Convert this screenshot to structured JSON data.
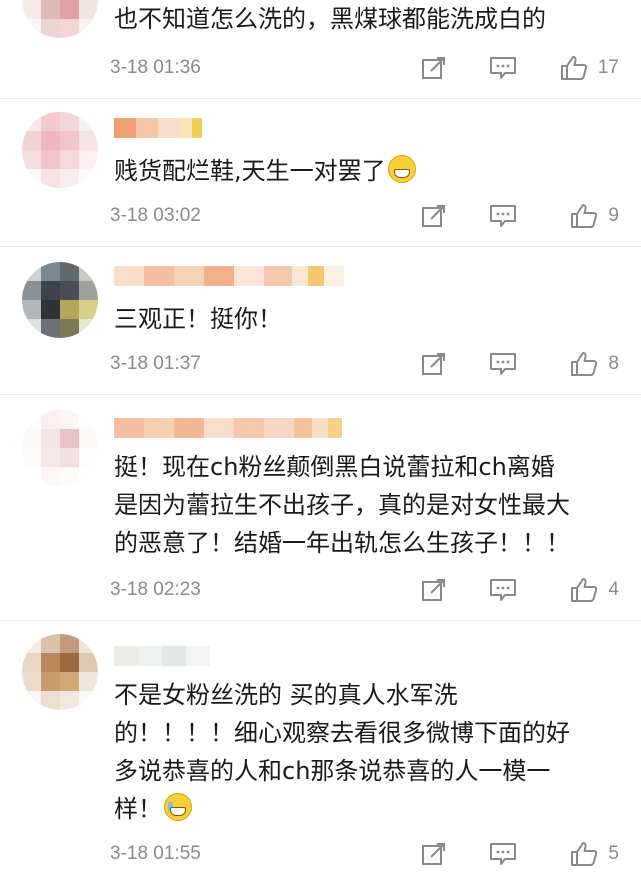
{
  "comments": [
    {
      "text": "也不知道怎么洗的，黑煤球都能洗成白的",
      "time": "3-18 01:36",
      "likes": "17",
      "emoji": ""
    },
    {
      "text": "贱货配烂鞋,天生一对罢了",
      "time": "3-18 03:02",
      "likes": "9",
      "emoji": "grin"
    },
    {
      "text": "三观正！挺你！",
      "time": "3-18 01:37",
      "likes": "8",
      "emoji": ""
    },
    {
      "text": "挺！现在ch粉丝颠倒黑白说蕾拉和ch离婚\n是因为蕾拉生不出孩子，真的是对女性最大\n的恶意了！结婚一年出轨怎么生孩子！！！",
      "time": "3-18 02:23",
      "likes": "4",
      "emoji": ""
    },
    {
      "text": "不是女粉丝洗的 买的真人水军洗\n的！！！！细心观察去看很多微博下面的好\n多说恭喜的人和ch那条说恭喜的人一模一\n样！",
      "time": "3-18 01:55",
      "likes": "5",
      "emoji": "cry"
    }
  ],
  "icons": {
    "share": "share-icon",
    "comment": "comment-icon",
    "like": "thumbs-up-icon"
  },
  "colors": {
    "text": "#1a1a1a",
    "meta": "#8a8a8a",
    "divider": "#e8e8e8"
  }
}
